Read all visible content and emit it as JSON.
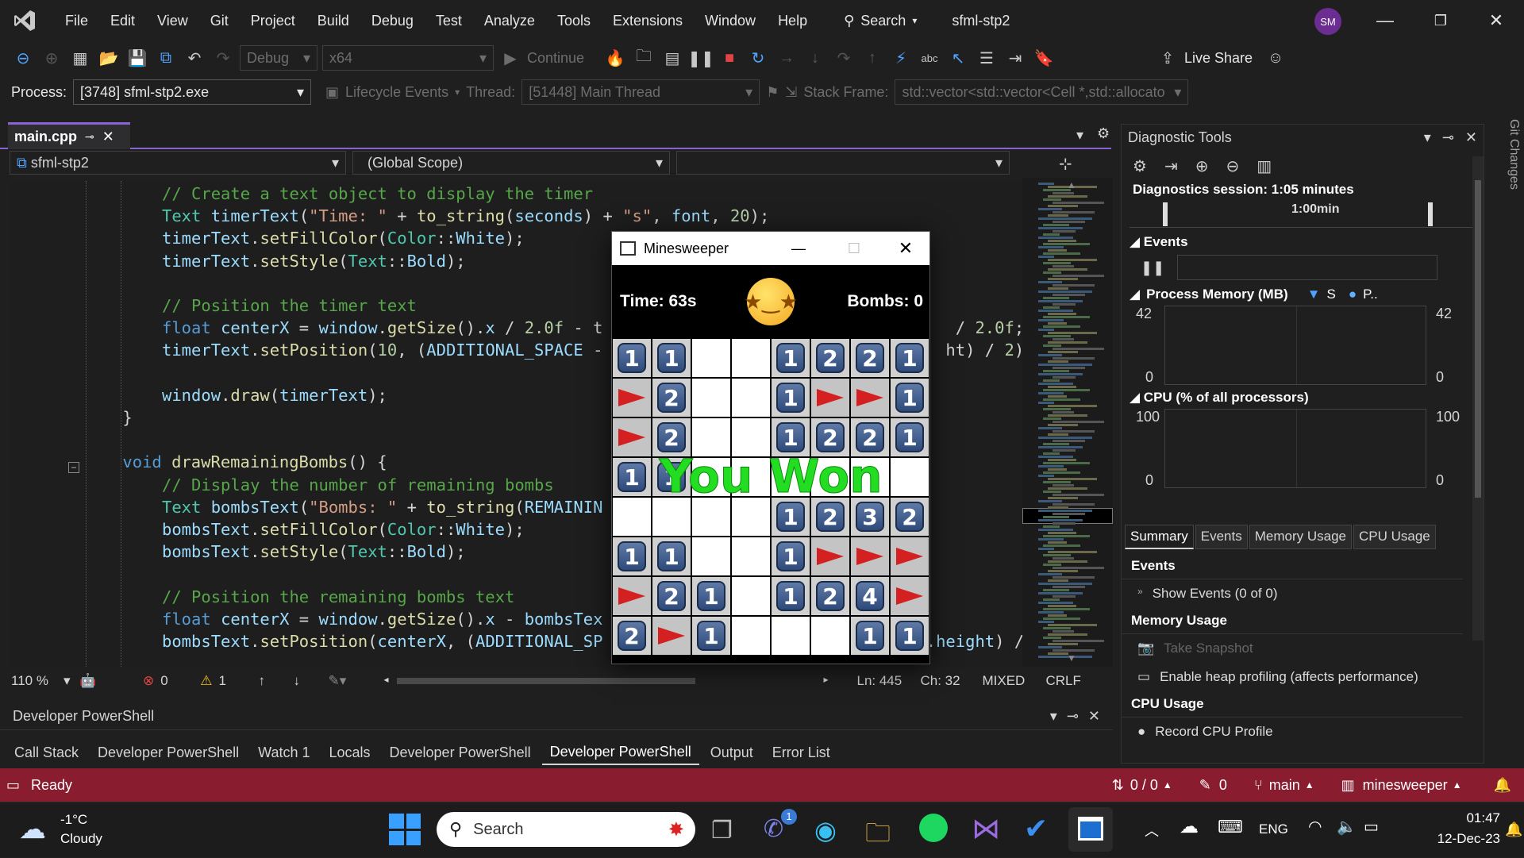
{
  "menubar": {
    "items": [
      "File",
      "Edit",
      "View",
      "Git",
      "Project",
      "Build",
      "Debug",
      "Test",
      "Analyze",
      "Tools",
      "Extensions",
      "Window",
      "Help"
    ],
    "search_label": "Search",
    "solution_name": "sfml-stp2",
    "avatar_initials": "SM"
  },
  "toolbar": {
    "config": "Debug",
    "platform": "x64",
    "continue_label": "Continue",
    "live_share": "Live Share"
  },
  "procbar": {
    "process_label": "Process:",
    "process_value": "[3748] sfml-stp2.exe",
    "lifecycle_label": "Lifecycle Events",
    "thread_label": "Thread:",
    "thread_value": "[51448] Main Thread",
    "stackframe_label": "Stack Frame:",
    "stackframe_value": "std::vector<std::vector<Cell *,std::allocato"
  },
  "editor": {
    "tab_name": "main.cpp",
    "project_scope": "sfml-stp2",
    "global_scope": "(Global Scope)",
    "zoom": "110 %",
    "errors": "0",
    "warnings": "1",
    "line": "Ln: 445",
    "col": "Ch: 32",
    "mode": "MIXED",
    "eol": "CRLF"
  },
  "bottom_panel": {
    "header": "Developer PowerShell",
    "tabs": [
      "Call Stack",
      "Developer PowerShell",
      "Watch 1",
      "Locals",
      "Developer PowerShell",
      "Developer PowerShell",
      "Output",
      "Error List"
    ],
    "active_tab_index": 5
  },
  "diagnostics": {
    "title": "Diagnostic Tools",
    "session": "Diagnostics session: 1:05 minutes",
    "timeline_label": "1:00min",
    "events_header": "Events",
    "memory_header": "Process Memory (MB)",
    "memory_legend_s": "S",
    "memory_legend_p": "P..",
    "memory_max": "42",
    "memory_min": "0",
    "cpu_header": "CPU (% of all processors)",
    "cpu_max": "100",
    "cpu_min": "0",
    "tabs": [
      "Summary",
      "Events",
      "Memory Usage",
      "CPU Usage"
    ],
    "summary_events": "Events",
    "show_events": "Show Events (0 of 0)",
    "summary_memory": "Memory Usage",
    "take_snapshot": "Take Snapshot",
    "heap_profiling": "Enable heap profiling (affects performance)",
    "summary_cpu": "CPU Usage",
    "record_cpu": "Record CPU Profile",
    "side_tab": "Git Changes"
  },
  "statusbar": {
    "ready": "Ready",
    "sync": "0 / 0",
    "edits": "0",
    "branch": "main",
    "repo": "minesweeper"
  },
  "taskbar": {
    "weather_temp": "-1°C",
    "weather_desc": "Cloudy",
    "search": "Search",
    "teams_badge": "1",
    "lang": "ENG",
    "time": "01:47",
    "date": "12-Dec-23"
  },
  "minesweeper": {
    "title": "Minesweeper",
    "time_label": "Time: 63s",
    "bombs_label": "Bombs: 0",
    "overlay": "You Won",
    "grid": [
      [
        "1",
        "1",
        "",
        "",
        "1",
        "2",
        "2",
        "1"
      ],
      [
        "F",
        "2",
        "",
        "",
        "1",
        "F",
        "F",
        "1"
      ],
      [
        "F",
        "2",
        "",
        "",
        "1",
        "2",
        "2",
        "1"
      ],
      [
        "1",
        "1",
        "",
        "",
        "",
        "",
        "",
        ""
      ],
      [
        "",
        "",
        "",
        "",
        "1",
        "2",
        "3",
        "2"
      ],
      [
        "1",
        "1",
        "",
        "",
        "1",
        "F",
        "F",
        "F"
      ],
      [
        "F",
        "2",
        "1",
        "",
        "1",
        "2",
        "4",
        "F"
      ],
      [
        "2",
        "F",
        "1",
        "",
        "",
        "",
        "1",
        "1"
      ]
    ]
  },
  "code_lines": [
    {
      "parts": [
        [
          "cm",
          "// Create a text object to display the timer"
        ]
      ]
    },
    {
      "parts": [
        [
          "ty",
          "Text "
        ],
        [
          "vr",
          "timerText"
        ],
        [
          "pl",
          "("
        ],
        [
          "st",
          "\"Time: \""
        ],
        [
          "pl",
          " + "
        ],
        [
          "fn",
          "to_string"
        ],
        [
          "pl",
          "("
        ],
        [
          "vr",
          "seconds"
        ],
        [
          "pl",
          ") + "
        ],
        [
          "st",
          "\"s\""
        ],
        [
          "pl",
          ", "
        ],
        [
          "vr",
          "font"
        ],
        [
          "pl",
          ", "
        ],
        [
          "nm",
          "20"
        ],
        [
          "pl",
          ");"
        ]
      ]
    },
    {
      "parts": [
        [
          "vr",
          "timerText"
        ],
        [
          "pl",
          "."
        ],
        [
          "fn",
          "setFillColor"
        ],
        [
          "pl",
          "("
        ],
        [
          "ty",
          "Color"
        ],
        [
          "pl",
          "::"
        ],
        [
          "vr",
          "White"
        ],
        [
          "pl",
          ");"
        ]
      ]
    },
    {
      "parts": [
        [
          "vr",
          "timerText"
        ],
        [
          "pl",
          "."
        ],
        [
          "fn",
          "setStyle"
        ],
        [
          "pl",
          "("
        ],
        [
          "ty",
          "Text"
        ],
        [
          "pl",
          "::"
        ],
        [
          "vr",
          "Bold"
        ],
        [
          "pl",
          ");"
        ]
      ]
    },
    {
      "parts": []
    },
    {
      "parts": [
        [
          "cm",
          "// Position the timer text"
        ]
      ]
    },
    {
      "parts": [
        [
          "kw",
          "float "
        ],
        [
          "vr",
          "centerX"
        ],
        [
          "pl",
          " = "
        ],
        [
          "vr",
          "window"
        ],
        [
          "pl",
          "."
        ],
        [
          "fn",
          "getSize"
        ],
        [
          "pl",
          "()."
        ],
        [
          "vr",
          "x"
        ],
        [
          "pl",
          " / "
        ],
        [
          "nm",
          "2.0f"
        ],
        [
          "pl",
          " - t                                    / "
        ],
        [
          "nm",
          "2.0f"
        ],
        [
          "pl",
          ";"
        ]
      ]
    },
    {
      "parts": [
        [
          "vr",
          "timerText"
        ],
        [
          "pl",
          "."
        ],
        [
          "fn",
          "setPosition"
        ],
        [
          "pl",
          "("
        ],
        [
          "nm",
          "10"
        ],
        [
          "pl",
          ", ("
        ],
        [
          "vr",
          "ADDITIONAL_SPACE"
        ],
        [
          "pl",
          " -                                   ht) / "
        ],
        [
          "nm",
          "2"
        ],
        [
          "pl",
          ");"
        ]
      ]
    },
    {
      "parts": []
    },
    {
      "parts": [
        [
          "vr",
          "window"
        ],
        [
          "pl",
          "."
        ],
        [
          "fn",
          "draw"
        ],
        [
          "pl",
          "("
        ],
        [
          "vr",
          "timerText"
        ],
        [
          "pl",
          ");"
        ]
      ]
    },
    {
      "indent": -4,
      "parts": [
        [
          "pl",
          "}"
        ]
      ]
    },
    {
      "parts": []
    },
    {
      "indent": -4,
      "parts": [
        [
          "kw",
          "void "
        ],
        [
          "fn",
          "drawRemainingBombs"
        ],
        [
          "pl",
          "() {"
        ]
      ]
    },
    {
      "parts": [
        [
          "cm",
          "// Display the number of remaining bombs"
        ]
      ]
    },
    {
      "parts": [
        [
          "ty",
          "Text "
        ],
        [
          "vr",
          "bombsText"
        ],
        [
          "pl",
          "("
        ],
        [
          "st",
          "\"Bombs: \""
        ],
        [
          "pl",
          " + "
        ],
        [
          "fn",
          "to_string"
        ],
        [
          "pl",
          "("
        ],
        [
          "vr",
          "REMAININ"
        ]
      ]
    },
    {
      "parts": [
        [
          "vr",
          "bombsText"
        ],
        [
          "pl",
          "."
        ],
        [
          "fn",
          "setFillColor"
        ],
        [
          "pl",
          "("
        ],
        [
          "ty",
          "Color"
        ],
        [
          "pl",
          "::"
        ],
        [
          "vr",
          "White"
        ],
        [
          "pl",
          ");"
        ]
      ]
    },
    {
      "parts": [
        [
          "vr",
          "bombsText"
        ],
        [
          "pl",
          "."
        ],
        [
          "fn",
          "setStyle"
        ],
        [
          "pl",
          "("
        ],
        [
          "ty",
          "Text"
        ],
        [
          "pl",
          "::"
        ],
        [
          "vr",
          "Bold"
        ],
        [
          "pl",
          ");"
        ]
      ]
    },
    {
      "parts": []
    },
    {
      "parts": [
        [
          "cm",
          "// Position the remaining bombs text"
        ]
      ]
    },
    {
      "parts": [
        [
          "kw",
          "float "
        ],
        [
          "vr",
          "centerX"
        ],
        [
          "pl",
          " = "
        ],
        [
          "vr",
          "window"
        ],
        [
          "pl",
          "."
        ],
        [
          "fn",
          "getSize"
        ],
        [
          "pl",
          "()."
        ],
        [
          "vr",
          "x"
        ],
        [
          "pl",
          " - "
        ],
        [
          "vr",
          "bombsTex"
        ]
      ]
    },
    {
      "parts": [
        [
          "vr",
          "bombsText"
        ],
        [
          "pl",
          "."
        ],
        [
          "fn",
          "setPosition"
        ],
        [
          "pl",
          "("
        ],
        [
          "vr",
          "centerX"
        ],
        [
          "pl",
          ", ("
        ],
        [
          "vr",
          "ADDITIONAL_SP"
        ],
        [
          "pl",
          "                                 ."
        ],
        [
          "vr",
          "height"
        ],
        [
          "pl",
          ") /"
        ]
      ]
    }
  ]
}
